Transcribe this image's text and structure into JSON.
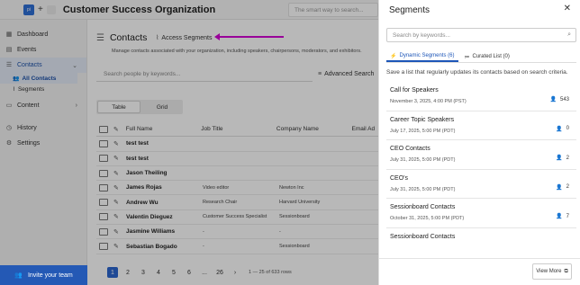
{
  "topbar": {
    "logo_text": "pi",
    "plus": "+",
    "org_title": "Customer Success Organization",
    "search_placeholder": "The smart way to search..."
  },
  "sidebar": {
    "items": [
      {
        "label": "Dashboard",
        "icon": "dashboard-icon",
        "glyph": "▦"
      },
      {
        "label": "Events",
        "icon": "calendar-icon",
        "glyph": "▤"
      },
      {
        "label": "Contacts",
        "icon": "contacts-icon",
        "glyph": "☰",
        "chevron": "⌄"
      },
      {
        "label": "Content",
        "icon": "content-icon",
        "glyph": "▭",
        "chevron": "›"
      },
      {
        "label": "History",
        "icon": "history-icon",
        "glyph": "◷"
      },
      {
        "label": "Settings",
        "icon": "settings-icon",
        "glyph": "⚙"
      }
    ],
    "sub_items": [
      {
        "label": "All Contacts",
        "glyph": "👥"
      },
      {
        "label": "Segments",
        "glyph": "⌇"
      }
    ],
    "invite_label": "Invite your team",
    "invite_glyph": "👥"
  },
  "main": {
    "title": "Contacts",
    "access_segments": "Access Segments",
    "description": "Manage contacts associated with your organization, including speakers, chairpersons, moderators, and exhibitors.",
    "search_placeholder": "Search people by keywords...",
    "advanced_search": "Advanced Search",
    "view_tabs": [
      "Table",
      "Grid"
    ],
    "table": {
      "headers": [
        "Full Name",
        "Job Title",
        "Company Name",
        "Email Ad"
      ],
      "rows": [
        {
          "name": "test test",
          "job": "",
          "company": ""
        },
        {
          "name": "test test",
          "job": "",
          "company": ""
        },
        {
          "name": "Jason Theiling",
          "job": "",
          "company": ""
        },
        {
          "name": "James Rojas",
          "job": "Video editor",
          "company": "Newton Inc"
        },
        {
          "name": "Andrew Wu",
          "job": "Research Chair",
          "company": "Harvard University"
        },
        {
          "name": "Valentin Dieguez",
          "job": "Customer Success Specialist",
          "company": "Sessionboard"
        },
        {
          "name": "Jasmine Williams",
          "job": "-",
          "company": "-"
        },
        {
          "name": "Sebastian Bogado",
          "job": "-",
          "company": "Sessionboard"
        }
      ]
    },
    "pagination": {
      "pages": [
        "1",
        "2",
        "3",
        "4",
        "5",
        "6",
        "...",
        "26",
        "›"
      ],
      "info": "1 — 25 of 633 rows"
    }
  },
  "panel": {
    "title": "Segments",
    "close": "✕",
    "search_placeholder": "Search by keywords...",
    "tabs": [
      {
        "label": "Dynamic Segments (6)",
        "glyph": "⚡"
      },
      {
        "label": "Curated List (0)",
        "glyph": "≔"
      }
    ],
    "help": "Save a list that regularly updates its contacts based on search criteria.",
    "segments": [
      {
        "name": "Call for Speakers",
        "date": "November 3, 2025, 4:00 PM (PST)",
        "count": "543"
      },
      {
        "name": "Career Topic Speakers",
        "date": "July 17, 2025, 5:00 PM (PDT)",
        "count": "0"
      },
      {
        "name": "CEO Contacts",
        "date": "July 31, 2025, 5:00 PM (PDT)",
        "count": "2"
      },
      {
        "name": "CEO's",
        "date": "July 31, 2025, 5:00 PM (PDT)",
        "count": "2"
      },
      {
        "name": "Sessionboard Contacts",
        "date": "October 31, 2025, 5:00 PM (PDT)",
        "count": "7"
      },
      {
        "name": "Sessionboard Contacts",
        "date": "",
        "count": ""
      }
    ],
    "view_more": "View More"
  },
  "colors": {
    "brand_blue": "#2459b5",
    "active_blue": "#2b66cf",
    "annotation_arrow": "#d400d4"
  }
}
